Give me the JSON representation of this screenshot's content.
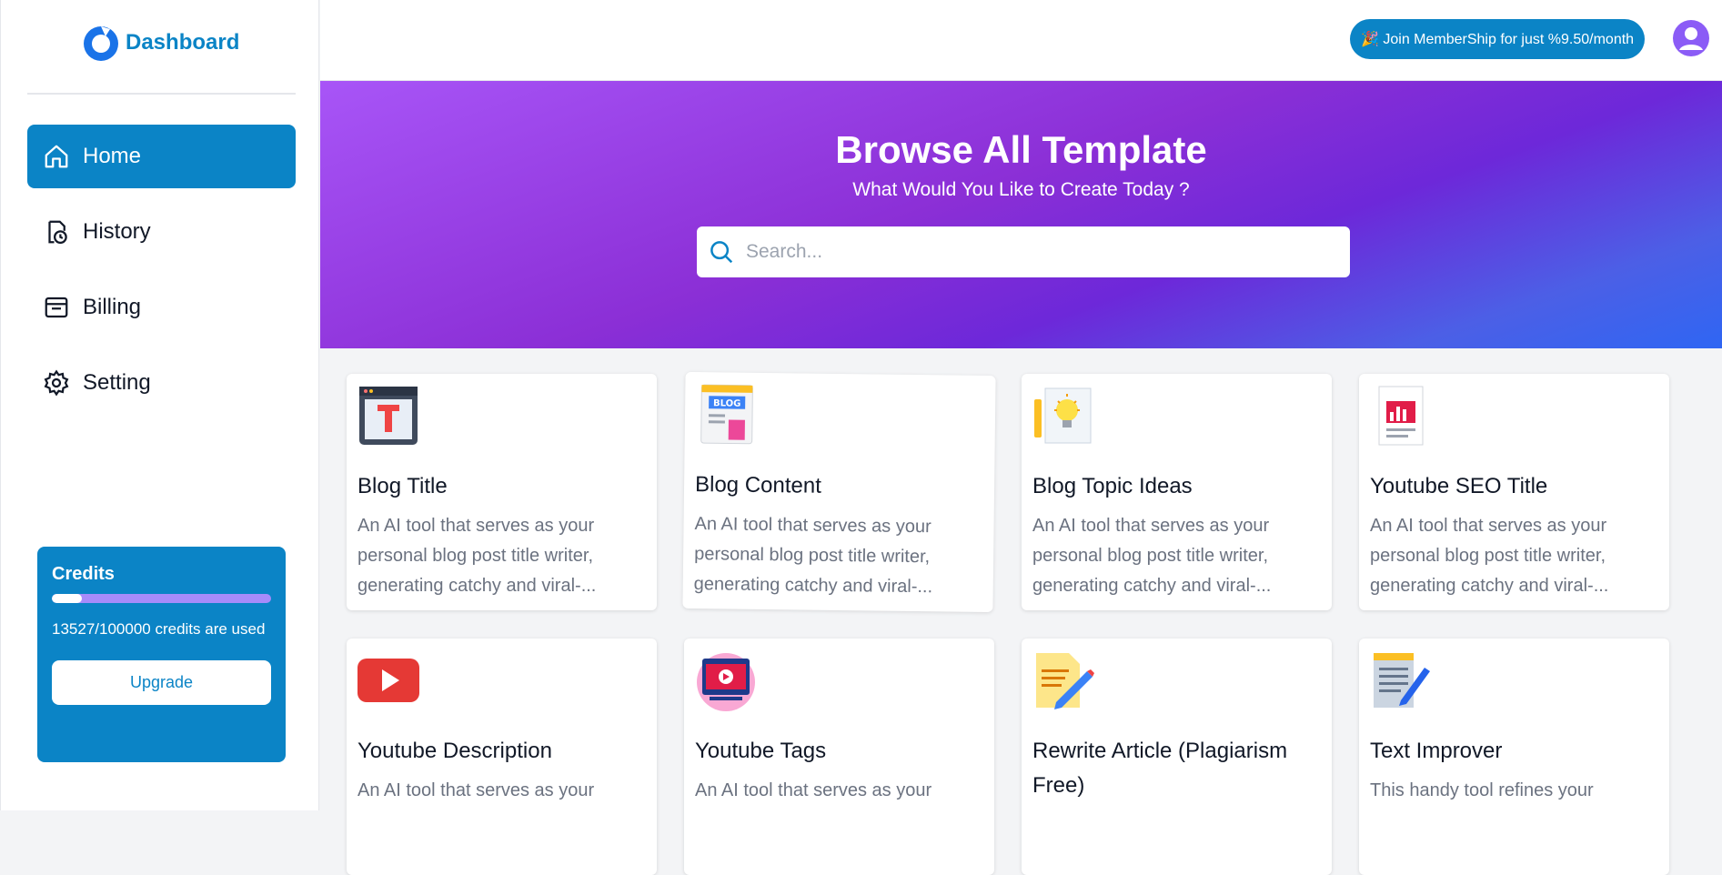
{
  "sidebar": {
    "brand": "Dashboard",
    "items": [
      {
        "label": "Home",
        "active": true
      },
      {
        "label": "History"
      },
      {
        "label": "Billing"
      },
      {
        "label": "Setting"
      }
    ],
    "credits": {
      "title": "Credits",
      "used": 13527,
      "total": 100000,
      "text": "13527/100000 credits are used",
      "upgrade_label": "Upgrade"
    }
  },
  "header": {
    "membership_label": "🎉 Join MemberShip for just %9.50/month"
  },
  "hero": {
    "title": "Browse All Template",
    "subtitle": "What Would You Like to Create Today ?",
    "search_placeholder": "Search..."
  },
  "templates": [
    {
      "title": "Blog Title",
      "desc": "An AI tool that serves as your personal blog post title writer, generating catchy and viral-...",
      "icon": "blog-title-icon"
    },
    {
      "title": "Blog Content",
      "desc": "An AI tool that serves as your personal blog post title writer, generating catchy and viral-...",
      "icon": "blog-content-icon"
    },
    {
      "title": "Blog Topic Ideas",
      "desc": "An AI tool that serves as your personal blog post title writer, generating catchy and viral-...",
      "icon": "lightbulb-icon"
    },
    {
      "title": "Youtube SEO Title",
      "desc": "An AI tool that serves as your personal blog post title writer, generating catchy and viral-...",
      "icon": "seo-chart-icon"
    },
    {
      "title": "Youtube Description",
      "desc": "An AI tool that serves as your",
      "icon": "youtube-icon"
    },
    {
      "title": "Youtube Tags",
      "desc": "An AI tool that serves as your",
      "icon": "video-tags-icon"
    },
    {
      "title": "Rewrite Article (Plagiarism Free)",
      "desc": "",
      "icon": "pencil-document-icon"
    },
    {
      "title": "Text Improver",
      "desc": "This handy tool refines your",
      "icon": "notepad-pen-icon"
    }
  ],
  "colors": {
    "accent": "#0b84c6",
    "hero_start": "#a855f7",
    "hero_end": "#2f66f3"
  }
}
